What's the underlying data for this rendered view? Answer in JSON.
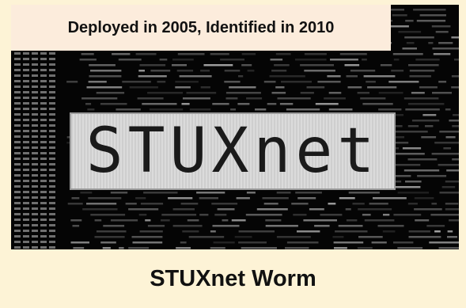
{
  "banner": {
    "text": "Deployed in 2005, Identified in 2010"
  },
  "logo": {
    "text": "STUXnet"
  },
  "caption": {
    "text": "STUXnet Worm"
  },
  "colors": {
    "background": "#fdf3d6",
    "banner_bg": "#fcecdc",
    "photo_bg": "#050505",
    "code_text": "#9a9a9a"
  }
}
